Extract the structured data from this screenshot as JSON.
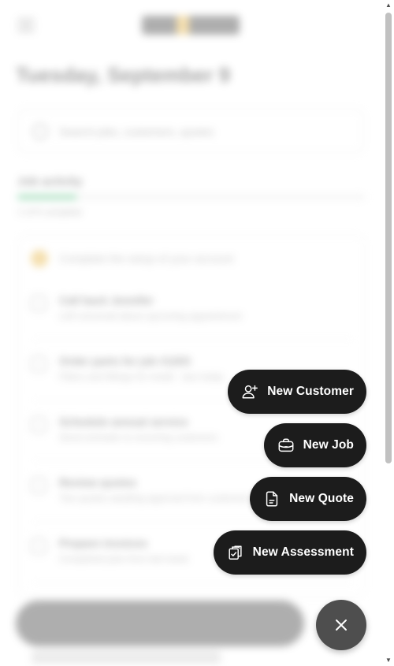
{
  "background": {
    "date_heading": "Tuesday, September 9",
    "search_placeholder": "Search jobs, customers, quotes",
    "section_title": "Job activity",
    "progress_fraction": 0.17,
    "progress_text": "1 of 6 complete",
    "alert_text": "Complete the setup of your account",
    "tasks": [
      {
        "title": "Call back Jennifer",
        "subtitle": "Left voicemail about upcoming appointment"
      },
      {
        "title": "Order parts for job #1203",
        "subtitle": "Filters and fittings for install · due today"
      },
      {
        "title": "Schedule annual service",
        "subtitle": "Send reminder to recurring customers"
      },
      {
        "title": "Review quotes",
        "subtitle": "Two quotes awaiting approval from customers"
      },
      {
        "title": "Prepare invoices",
        "subtitle": "Completed jobs from last week"
      }
    ]
  },
  "fab_menu": {
    "actions": [
      {
        "label": "New Customer",
        "icon": "add-user-icon"
      },
      {
        "label": "New Job",
        "icon": "briefcase-icon"
      },
      {
        "label": "New Quote",
        "icon": "document-icon"
      },
      {
        "label": "New Assessment",
        "icon": "clipboard-check-icon"
      }
    ],
    "close_icon": "close-icon"
  },
  "colors": {
    "action_bg": "#1c1c1c",
    "close_bg": "#4e4e4e",
    "action_text": "#ffffff",
    "progress": "#27ae60",
    "accent": "#e6b23c"
  }
}
